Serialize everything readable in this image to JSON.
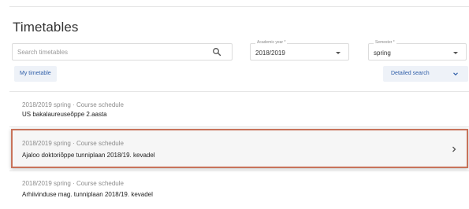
{
  "header": {
    "title": "Timetables"
  },
  "search": {
    "placeholder": "Search timetables",
    "icon": "search-icon"
  },
  "filters": {
    "academic_year": {
      "label": "Academic year *",
      "value": "2018/2019"
    },
    "semester": {
      "label": "Semester *",
      "value": "spring"
    }
  },
  "actions": {
    "my_timetable": "My timetable",
    "detailed_search": "Detailed search"
  },
  "timetables": [
    {
      "meta": "2018/2019 spring · Course schedule",
      "name": "US bakalaureuseõppe 2.aasta"
    },
    {
      "meta": "2018/2019 spring · Course schedule",
      "name": "Ajaloo doktoriõppe tunniplaan 2018/19. kevadel"
    },
    {
      "meta": "2018/2019 spring · Course schedule",
      "name": "Arhiivinduse mag. tunniplaan 2018/19. kevadel"
    }
  ],
  "colors": {
    "accent": "#2f5ea8",
    "highlight_border": "#c8735a"
  }
}
